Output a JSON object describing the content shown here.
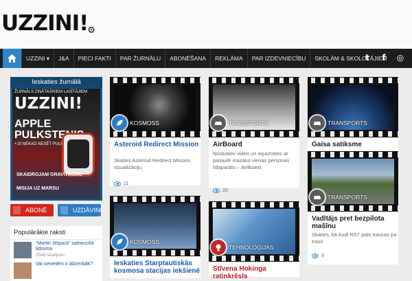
{
  "header": {
    "logo_text": "UZZINI!",
    "logo_mark": "⚙"
  },
  "nav": {
    "items": [
      {
        "label": "UZZINI ▾"
      },
      {
        "label": "J&A"
      },
      {
        "label": "PIECI FAKTI"
      },
      {
        "label": "PAR ŽURNĀLU"
      },
      {
        "label": "ABONĒŠANA"
      },
      {
        "label": "REKLĀMA"
      },
      {
        "label": "PAR IZDEVNIECĪBU"
      },
      {
        "label": "SKOLĀM & SKOLOTĀJIEM"
      }
    ],
    "social": [
      {
        "icon": "twitter-icon",
        "glyph": "t"
      },
      {
        "icon": "facebook-icon",
        "glyph": "f"
      },
      {
        "icon": "instagram-icon",
        "glyph": "◎"
      }
    ]
  },
  "sidebar": {
    "magazine_title": "Ieskaties žurnālā",
    "cover": {
      "tagline": "ŽURNĀLS ZINĀTKĀRIEM LASĪTĀJIEM",
      "masthead": "UZZINI!",
      "headline": "APPLE PULKSTENIS",
      "subline": "+10 NEKAD NESĒT PULKSTEŅI",
      "story_gravity": "SKAIDROJAM GRAVITĀCIJU",
      "story_mars": "MISIJA UZ MARSU"
    },
    "subscribe_label": "ABONĒ",
    "tasks_label": "UZDĀVINI",
    "popular_title": "Populārākie raksti",
    "popular": [
      {
        "title": "\"Martin Jetpack\" satriecošā lidsoma",
        "views": "2549 skatījumi"
      },
      {
        "title": "Vai sievietēm ir ādzenbāk?",
        "views": ""
      }
    ]
  },
  "cards": [
    {
      "category": "KOSMOSS",
      "title": "Asteroid Redirect Mission",
      "desc": "Skaties Asteroid Redirect Mission vizualizāciju.",
      "views": "11",
      "accent": "#2e7cc4"
    },
    {
      "category": "TRANSPORTS",
      "title": "AirBoard",
      "desc": "Noskaties video un iepazīsties ar pasaulē mazāko vienas personas lidaparātu – AirBoard.",
      "views": "20",
      "accent": "#5b5b5b"
    },
    {
      "category": "TRANSPORTS",
      "title": "Gaisa satiksme",
      "desc": "",
      "views": "",
      "accent": "#5b5b5b"
    },
    {
      "category": "KOSMOSS",
      "title": "Ieskaties Starptautiskās kosmosa stacijas iekšienē",
      "desc": "",
      "views": "",
      "accent": "#2e7cc4"
    },
    {
      "category": "TEHNOLOĢIJAS",
      "title": "Stīvena Hokinga ratinkrēsls",
      "desc": "",
      "views": "",
      "accent": "#c0272d"
    },
    {
      "category": "TRANSPORTS",
      "title": "Vadītājs pret bezpilota mašīnu",
      "desc": "Skaties, kā Audi RS7 pats traucas pa trasi!",
      "views": "9",
      "accent": "#5b5b5b"
    }
  ]
}
